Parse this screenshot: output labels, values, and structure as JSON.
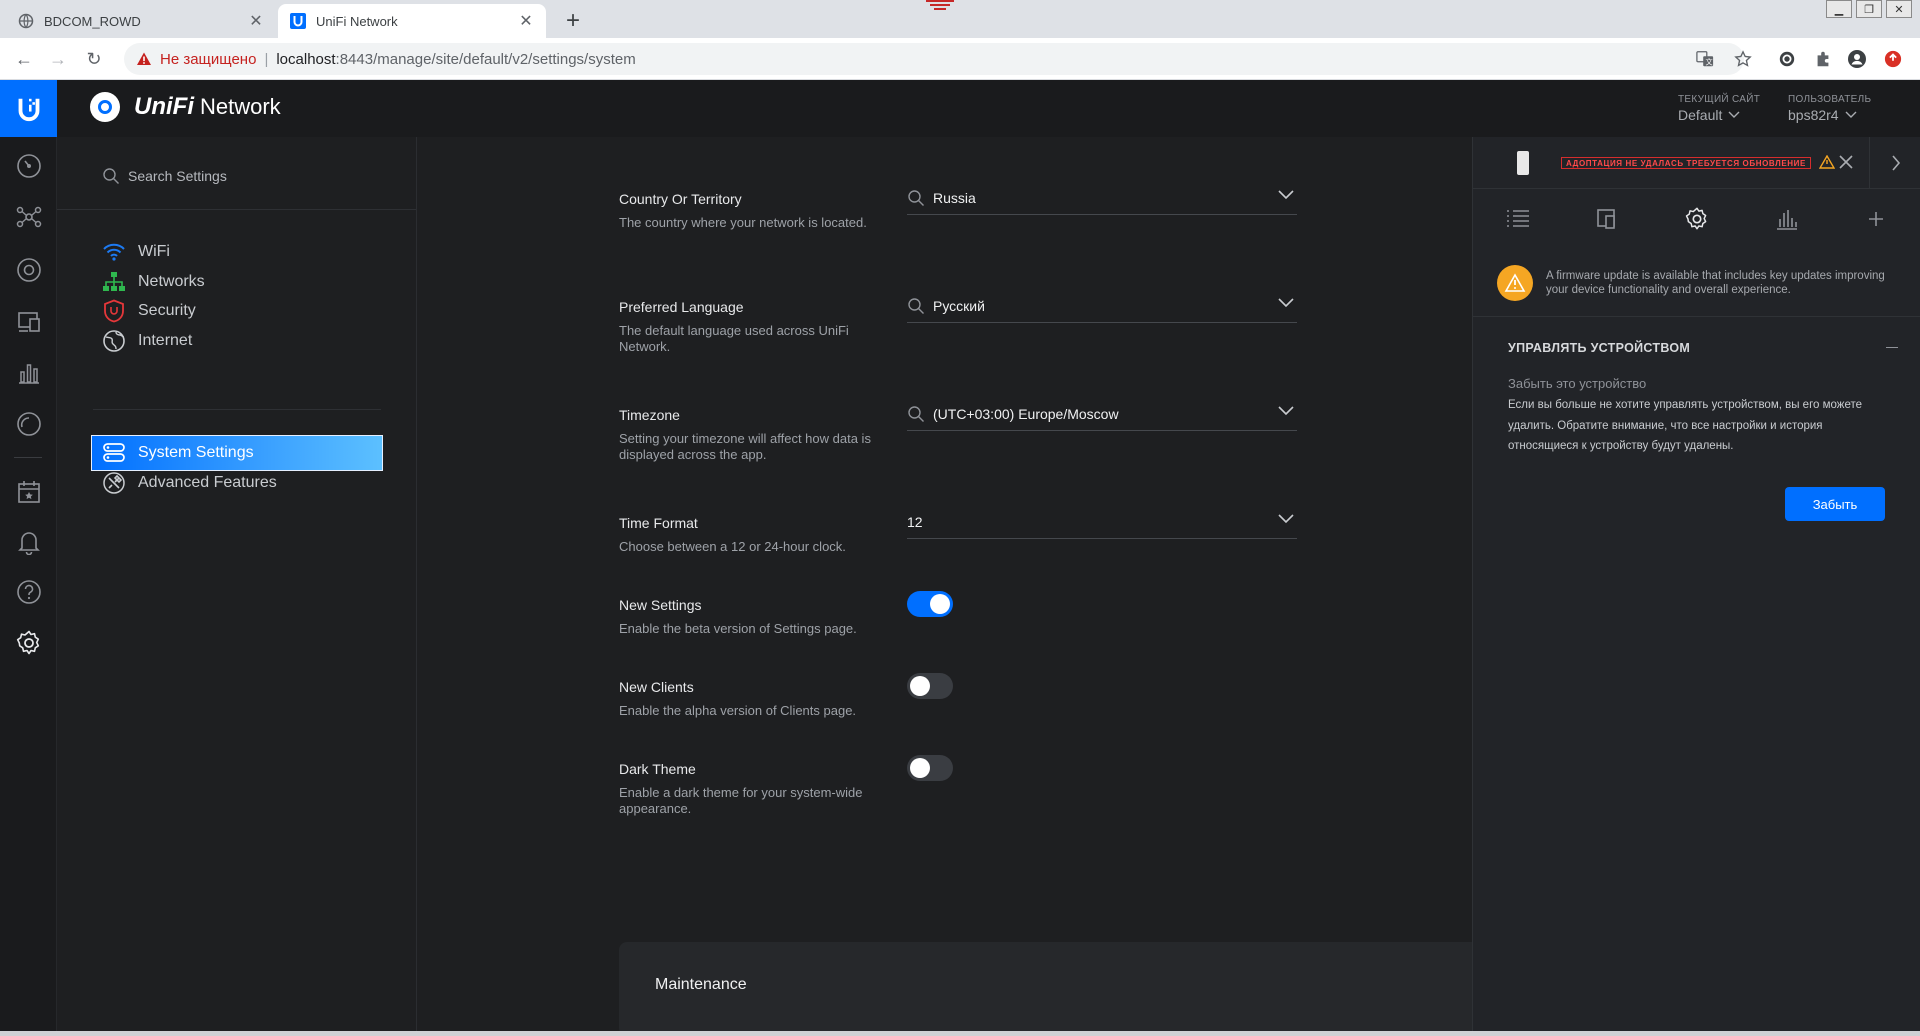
{
  "browser": {
    "tabs": [
      {
        "title": "BDCOM_ROWD",
        "icon": "globe-icon",
        "active": false
      },
      {
        "title": "UniFi Network",
        "icon": "unifi-favicon",
        "active": true
      }
    ],
    "address": {
      "security_label": "Не защищено",
      "host": "localhost",
      "path": ":8443/manage/site/default/v2/settings/system"
    }
  },
  "header": {
    "brand": "UniFi",
    "product": "Network",
    "site": {
      "label": "ТЕКУЩИЙ САЙТ",
      "value": "Default"
    },
    "user": {
      "label": "ПОЛЬЗОВАТЕЛЬ",
      "value": "bps82r4"
    }
  },
  "sidebar": {
    "search_placeholder": "Search Settings",
    "items": [
      {
        "label": "WiFi",
        "icon": "wifi-icon"
      },
      {
        "label": "Networks",
        "icon": "network-icon"
      },
      {
        "label": "Security",
        "icon": "shield-icon"
      },
      {
        "label": "Internet",
        "icon": "globe-icon"
      }
    ],
    "items2": [
      {
        "label": "System Settings",
        "icon": "server-icon",
        "active": true
      },
      {
        "label": "Advanced Features",
        "icon": "tools-icon",
        "active": false
      }
    ]
  },
  "settings": {
    "country": {
      "title": "Country Or Territory",
      "desc": "The country where your network is located.",
      "value": "Russia"
    },
    "language": {
      "title": "Preferred Language",
      "desc": "The default language used across UniFi Network.",
      "value": "Русский"
    },
    "timezone": {
      "title": "Timezone",
      "desc": "Setting your timezone will affect how data is displayed across the app.",
      "value": "(UTC+03:00) Europe/Moscow"
    },
    "time_format": {
      "title": "Time Format",
      "desc": "Choose between a 12 or 24-hour clock.",
      "value": "12"
    },
    "new_settings": {
      "title": "New Settings",
      "desc": "Enable the beta version of Settings page.",
      "enabled": true
    },
    "new_clients": {
      "title": "New Clients",
      "desc": "Enable the alpha version of Clients page.",
      "enabled": false
    },
    "dark_theme": {
      "title": "Dark Theme",
      "desc": "Enable a dark theme for your system-wide appearance.",
      "enabled": false
    }
  },
  "maintenance": {
    "title": "Maintenance"
  },
  "device_panel": {
    "status_badge": "АДОПТАЦИЯ НЕ УДАЛАСЬ  ТРЕБУЕТСЯ ОБНОВЛЕНИЕ",
    "firmware_alert": "A firmware update is available that includes key updates improving your device functionality and overall experience.",
    "manage_title": "УПРАВЛЯТЬ УСТРОЙСТВОМ",
    "forget_label": "Забыть это устройство",
    "forget_desc": "Если вы больше не хотите управлять устройством, вы его можете удалить. Обратите внимание, что все настройки и история относящиеся к устройству будут удалены.",
    "forget_button": "Забыть"
  },
  "colors": {
    "accent": "#006fff",
    "warning": "#f5a623",
    "error": "#d62d2d",
    "background": "#1e1f21"
  }
}
